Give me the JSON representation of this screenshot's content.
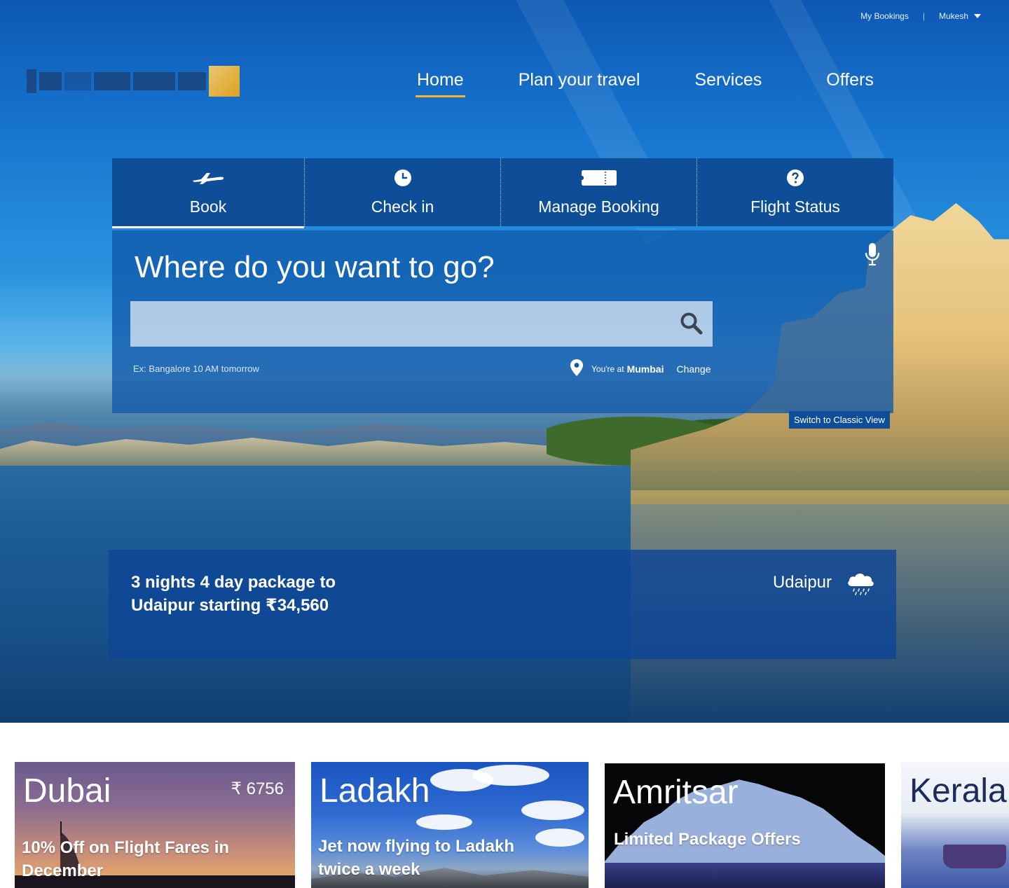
{
  "topbar": {
    "my_bookings": "My Bookings",
    "separator": "|",
    "user": "Mukesh"
  },
  "nav": {
    "home": "Home",
    "plan": "Plan your travel",
    "services": "Services",
    "offers": "Offers"
  },
  "tabs": {
    "book": "Book",
    "checkin": "Check in",
    "manage": "Manage Booking",
    "status": "Flight Status"
  },
  "search": {
    "heading": "Where do you want to go?",
    "value": "",
    "hint": "Ex: Bangalore 10 AM tomorrow",
    "location_prefix": "You're at",
    "location_city": "Mumbai",
    "change": "Change",
    "classic_view": "Switch to Classic View"
  },
  "promo": {
    "line1": "3 nights 4 day package to",
    "line2": "Udaipur starting ₹34,560",
    "city": "Udaipur",
    "weather_icon": "rain-cloud-icon"
  },
  "cards": {
    "dubai": {
      "title": "Dubai",
      "price": "₹ 6756",
      "line1": "10% Off on Flight Fares in",
      "line2": "December"
    },
    "ladakh": {
      "title": "Ladakh",
      "line1": "Jet now flying to Ladakh",
      "line2": "twice a week"
    },
    "amritsar": {
      "title": "Amritsar",
      "line1": "Limited Package Offers"
    },
    "kerala": {
      "title": "Kerala"
    }
  },
  "colors": {
    "brand_blue": "#0e4e98",
    "accent_yellow": "#f2b632",
    "tab_underline": "#1f8be0"
  }
}
